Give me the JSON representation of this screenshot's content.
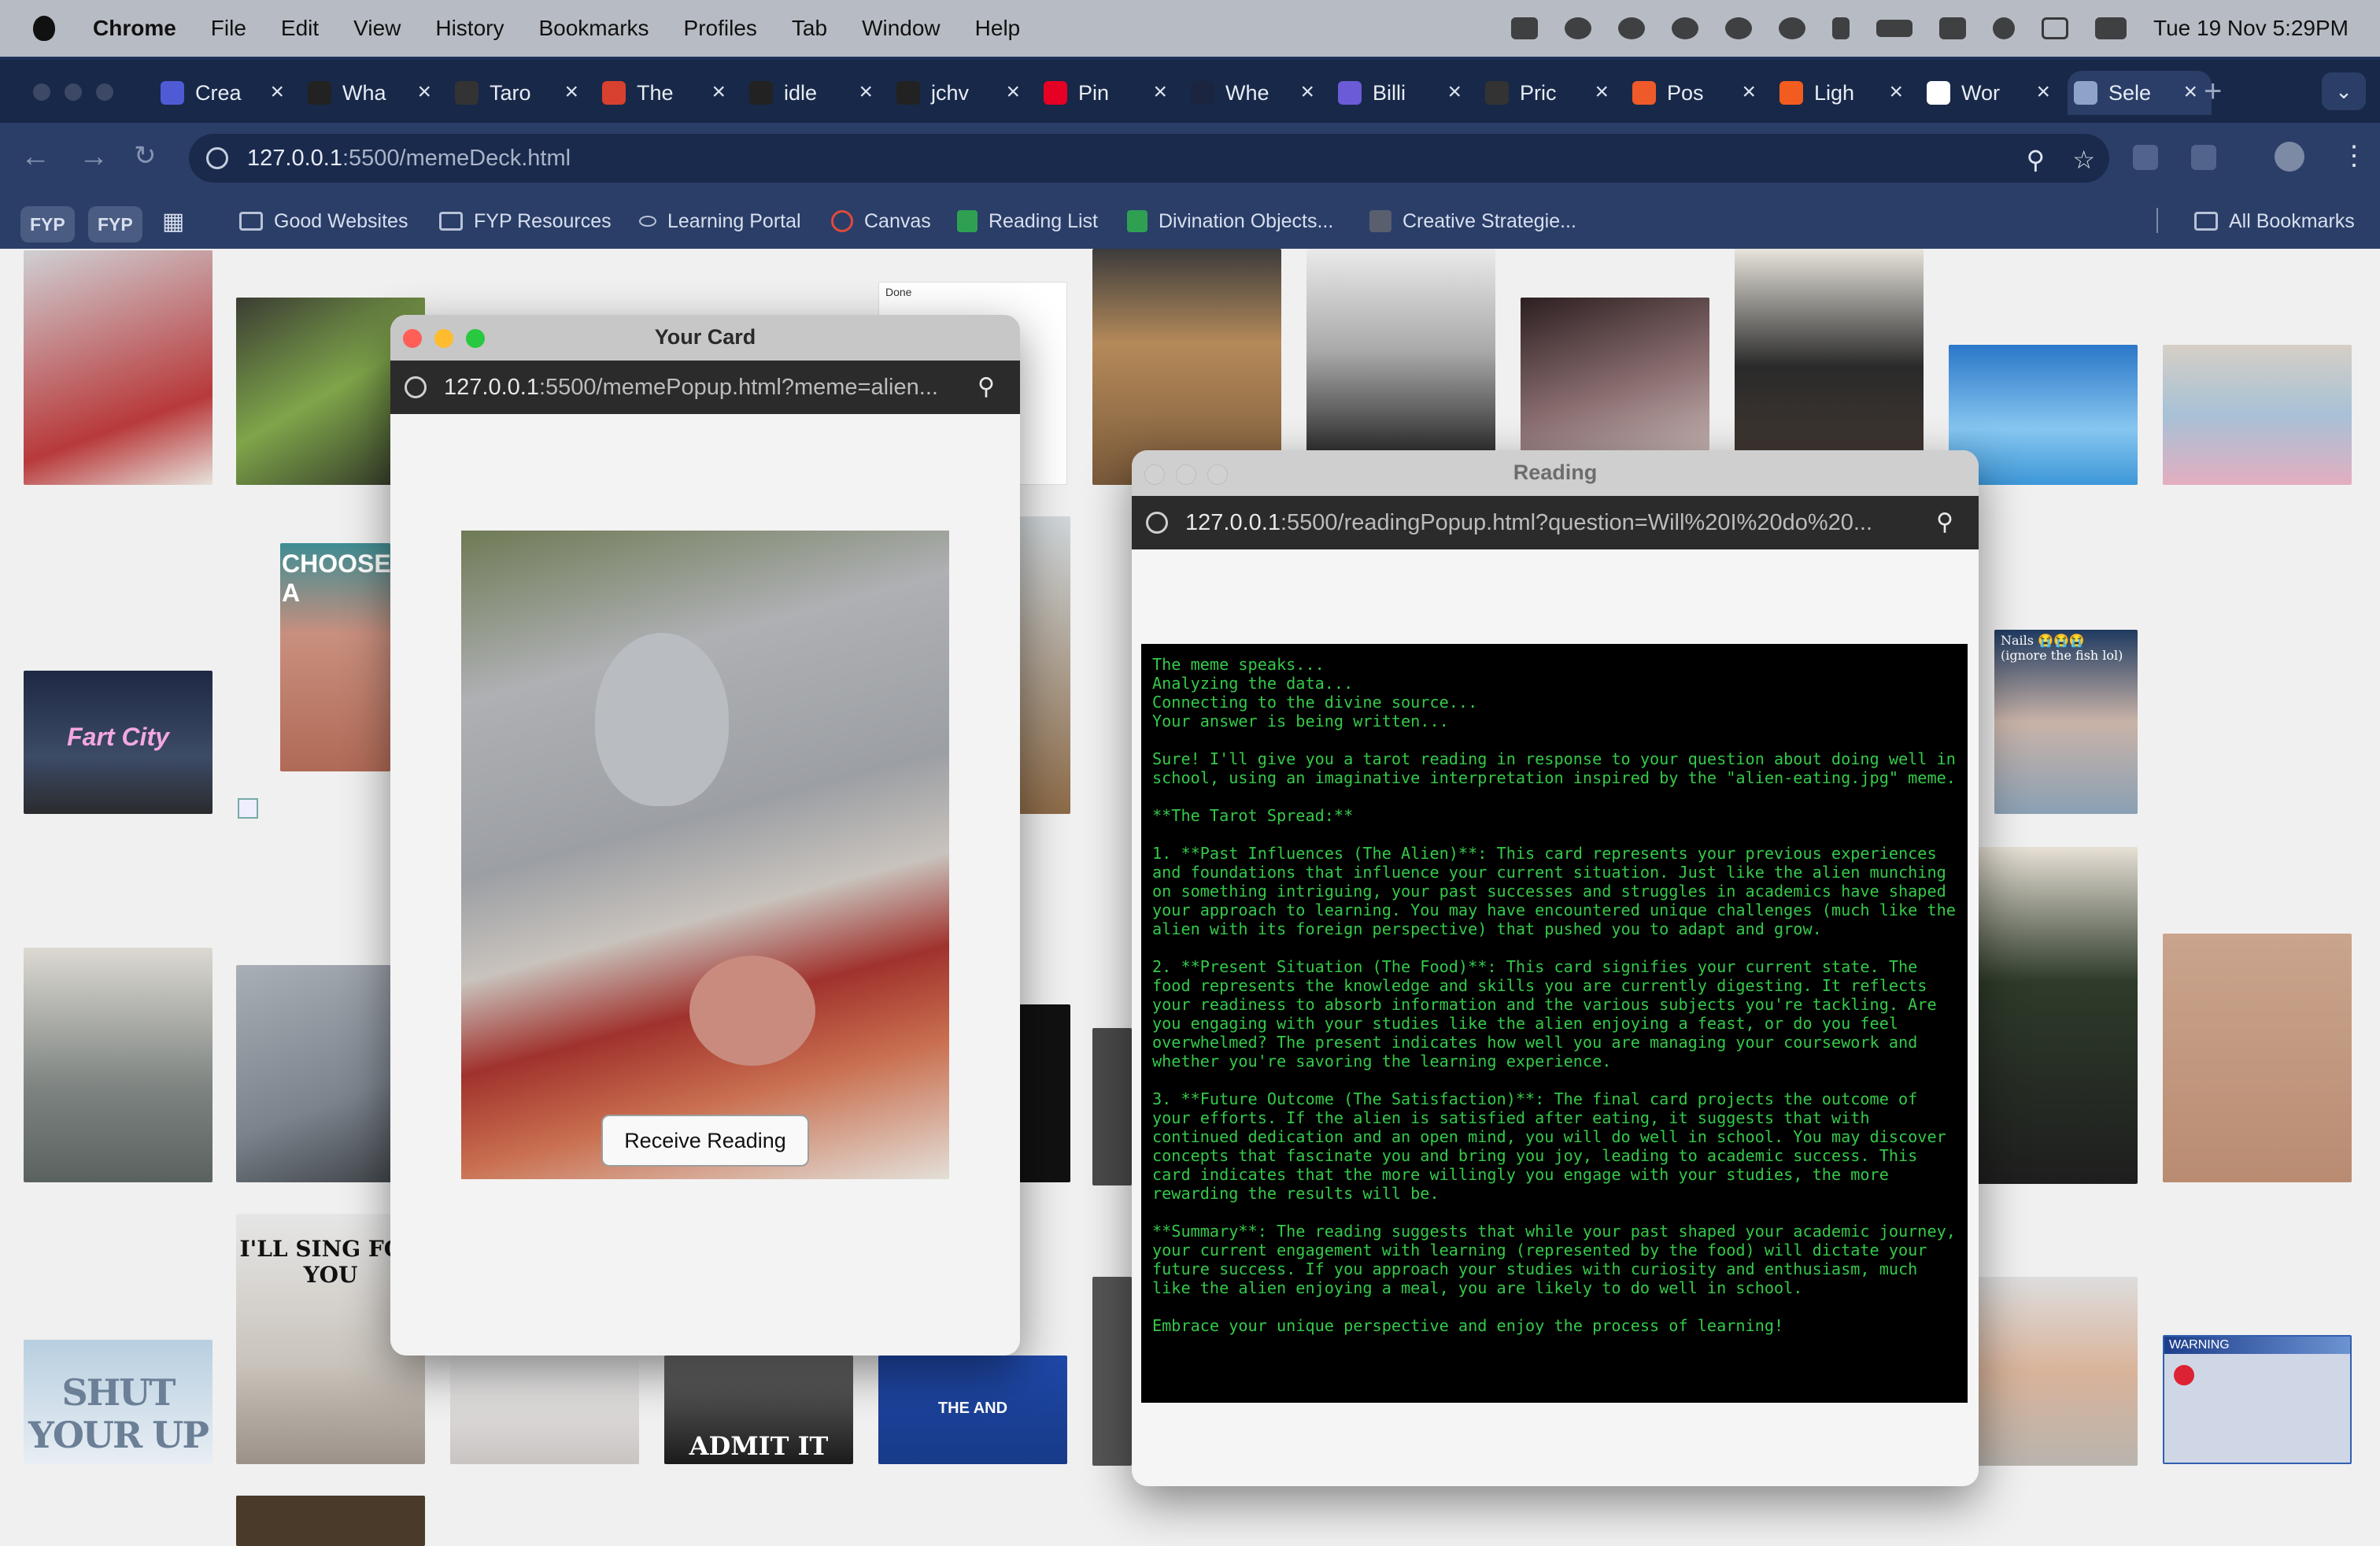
{
  "menubar": {
    "app": "Chrome",
    "menus": [
      "File",
      "Edit",
      "View",
      "History",
      "Bookmarks",
      "Profiles",
      "Tab",
      "Window",
      "Help"
    ],
    "datetime": "Tue 19 Nov  5:29PM"
  },
  "tabs": [
    {
      "label": "Crea",
      "color": "#4f5bd5"
    },
    {
      "label": "Wha",
      "color": "#222222"
    },
    {
      "label": "Taro",
      "color": "#333333"
    },
    {
      "label": "The",
      "color": "#d8412f"
    },
    {
      "label": "idle",
      "color": "#222222"
    },
    {
      "label": "jchv",
      "color": "#222222"
    },
    {
      "label": "Pin",
      "color": "#e60023"
    },
    {
      "label": "Whe",
      "color": "#1b2540"
    },
    {
      "label": "Billi",
      "color": "#6b5bd6"
    },
    {
      "label": "Pric",
      "color": "#333333"
    },
    {
      "label": "Pos",
      "color": "#ef5a2a"
    },
    {
      "label": "Ligh",
      "color": "#f25c1f"
    },
    {
      "label": "Wor",
      "color": "#ffffff"
    },
    {
      "label": "Sele",
      "color": "#8fa3c8"
    }
  ],
  "toolbar": {
    "url_host": "127.0.0.1",
    "url_path": ":5500/memeDeck.html"
  },
  "bookmarks": {
    "chip1": "FYP",
    "chip2": "FYP",
    "items": [
      "Good Websites",
      "FYP Resources",
      "Learning Portal",
      "Canvas",
      "Reading List",
      "Divination Objects...",
      "Creative Strategie..."
    ],
    "all": "All Bookmarks"
  },
  "thumbs": {
    "choose": "CHOOSE A",
    "fart_city": "Fart City",
    "nails": "Nails 😭😭😭 (ignore the fish lol)",
    "shut_your_up": "SHUT YOUR UP",
    "ill_sing": "I'LL SING FOR YOU",
    "admit_it": "ADMIT IT",
    "the_and": "THE AND",
    "warning": "WARNING",
    "done": "Done"
  },
  "card_window": {
    "title": "Your Card",
    "url_host": "127.0.0.1",
    "url_path": ":5500/memePopup.html?meme=alien...",
    "button": "Receive Reading"
  },
  "reading_window": {
    "title": "Reading",
    "url_host": "127.0.0.1",
    "url_path": ":5500/readingPopup.html?question=Will%20I%20do%20...",
    "lines": [
      "The meme speaks...",
      "Analyzing the data...",
      "Connecting to the divine source...",
      "Your answer is being written...",
      "",
      "Sure! I'll give you a tarot reading in response to your question about doing well in school, using an imaginative interpretation inspired by the \"alien-eating.jpg\" meme.",
      "",
      "**The Tarot Spread:**",
      "",
      "1. **Past Influences (The Alien)**: This card represents your previous experiences and foundations that influence your current situation. Just like the alien munching on something intriguing, your past successes and struggles in academics have shaped your approach to learning. You may have encountered unique challenges (much like the alien with its foreign perspective) that pushed you to adapt and grow.",
      "",
      "2. **Present Situation (The Food)**: This card signifies your current state. The food represents the knowledge and skills you are currently digesting. It reflects your readiness to absorb information and the various subjects you're tackling. Are you engaging with your studies like the alien enjoying a feast, or do you feel overwhelmed? The present indicates how well you are managing your coursework and whether you're savoring the learning experience.",
      "",
      "3. **Future Outcome (The Satisfaction)**: The final card projects the outcome of your efforts. If the alien is satisfied after eating, it suggests that with continued dedication and an open mind, you will do well in school. You may discover concepts that fascinate you and bring you joy, leading to academic success. This card indicates that the more willingly you engage with your studies, the more rewarding the results will be.",
      "",
      "**Summary**: The reading suggests that while your past shaped your academic journey, your current engagement with learning (represented by the food) will dictate your future success. If you approach your studies with curiosity and enthusiasm, much like the alien enjoying a meal, you are likely to do well in school.",
      "",
      "Embrace your unique perspective and enjoy the process of learning!"
    ]
  }
}
